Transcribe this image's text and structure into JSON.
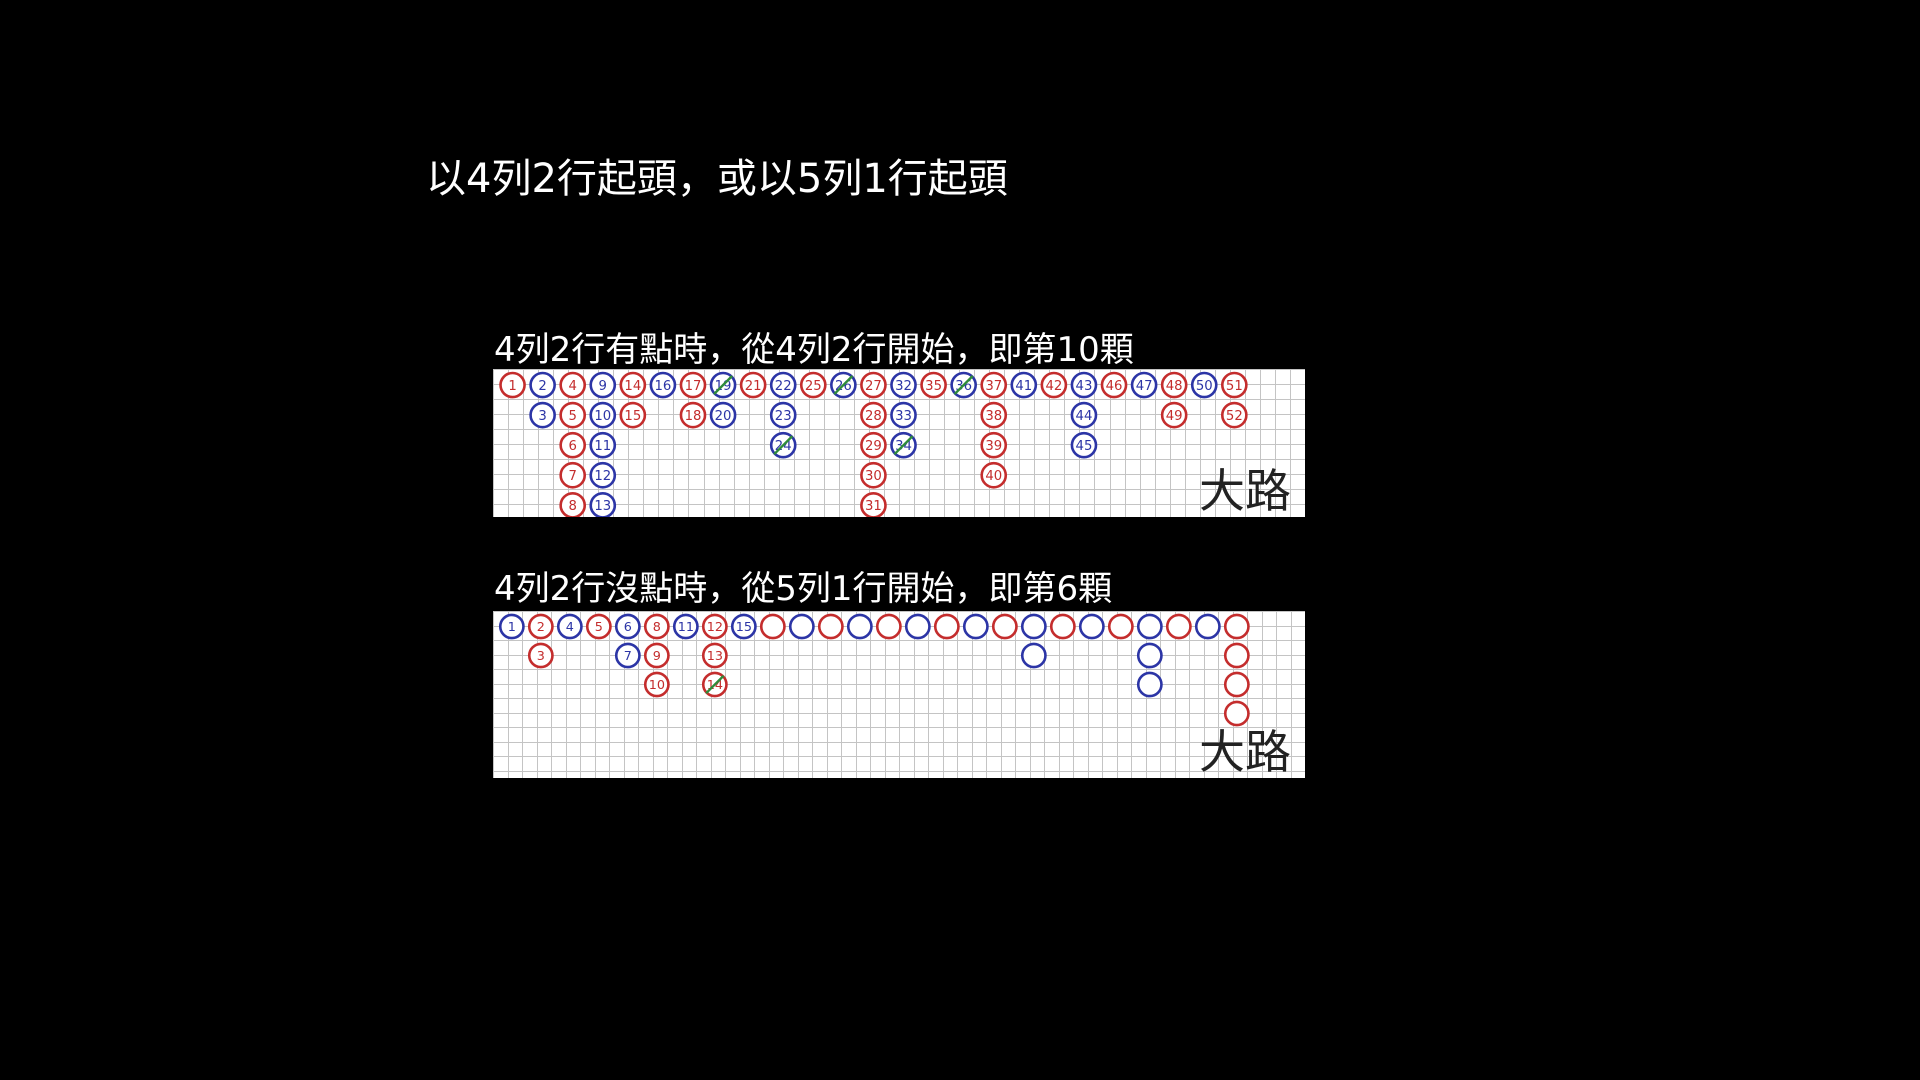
{
  "title": "以4列2行起頭，或以5列1行起頭",
  "colors": {
    "background": "#000000",
    "text": "#ffffff",
    "grid_bg": "#ffffff",
    "grid_line": "#c4c4c4",
    "banker": "#c42d2d",
    "player": "#2c35a6",
    "tie": "#2e8b3a"
  },
  "roads": [
    {
      "caption": "4列2行有點時，從4列2行開始，即第10顆",
      "label": "大路",
      "grid": {
        "cols": 27,
        "rows": 6
      },
      "beads": [
        {
          "col": 0,
          "row": 0,
          "color": "red",
          "n": "1"
        },
        {
          "col": 1,
          "row": 0,
          "color": "blue",
          "n": "2"
        },
        {
          "col": 1,
          "row": 1,
          "color": "blue",
          "n": "3"
        },
        {
          "col": 2,
          "row": 0,
          "color": "red",
          "n": "4"
        },
        {
          "col": 2,
          "row": 1,
          "color": "red",
          "n": "5"
        },
        {
          "col": 2,
          "row": 2,
          "color": "red",
          "n": "6"
        },
        {
          "col": 2,
          "row": 3,
          "color": "red",
          "n": "7"
        },
        {
          "col": 2,
          "row": 4,
          "color": "red",
          "n": "8"
        },
        {
          "col": 3,
          "row": 0,
          "color": "blue",
          "n": "9"
        },
        {
          "col": 3,
          "row": 1,
          "color": "blue",
          "n": "10"
        },
        {
          "col": 3,
          "row": 2,
          "color": "blue",
          "n": "11"
        },
        {
          "col": 3,
          "row": 3,
          "color": "blue",
          "n": "12"
        },
        {
          "col": 3,
          "row": 4,
          "color": "blue",
          "n": "13"
        },
        {
          "col": 4,
          "row": 0,
          "color": "red",
          "n": "14"
        },
        {
          "col": 4,
          "row": 1,
          "color": "red",
          "n": "15"
        },
        {
          "col": 5,
          "row": 0,
          "color": "blue",
          "n": "16"
        },
        {
          "col": 6,
          "row": 0,
          "color": "red",
          "n": "17"
        },
        {
          "col": 6,
          "row": 1,
          "color": "red",
          "n": "18"
        },
        {
          "col": 7,
          "row": 0,
          "color": "blue",
          "n": "19",
          "tie": true
        },
        {
          "col": 7,
          "row": 1,
          "color": "blue",
          "n": "20"
        },
        {
          "col": 8,
          "row": 0,
          "color": "red",
          "n": "21"
        },
        {
          "col": 9,
          "row": 0,
          "color": "blue",
          "n": "22"
        },
        {
          "col": 9,
          "row": 1,
          "color": "blue",
          "n": "23"
        },
        {
          "col": 9,
          "row": 2,
          "color": "blue",
          "n": "24",
          "tie": true
        },
        {
          "col": 10,
          "row": 0,
          "color": "red",
          "n": "25"
        },
        {
          "col": 11,
          "row": 0,
          "color": "blue",
          "n": "26",
          "tie": true
        },
        {
          "col": 12,
          "row": 0,
          "color": "red",
          "n": "27"
        },
        {
          "col": 12,
          "row": 1,
          "color": "red",
          "n": "28"
        },
        {
          "col": 12,
          "row": 2,
          "color": "red",
          "n": "29"
        },
        {
          "col": 12,
          "row": 3,
          "color": "red",
          "n": "30"
        },
        {
          "col": 12,
          "row": 4,
          "color": "red",
          "n": "31"
        },
        {
          "col": 13,
          "row": 0,
          "color": "blue",
          "n": "32"
        },
        {
          "col": 13,
          "row": 1,
          "color": "blue",
          "n": "33"
        },
        {
          "col": 13,
          "row": 2,
          "color": "blue",
          "n": "34",
          "tie": true
        },
        {
          "col": 14,
          "row": 0,
          "color": "red",
          "n": "35"
        },
        {
          "col": 15,
          "row": 0,
          "color": "blue",
          "n": "36",
          "tie": true
        },
        {
          "col": 16,
          "row": 0,
          "color": "red",
          "n": "37"
        },
        {
          "col": 16,
          "row": 1,
          "color": "red",
          "n": "38"
        },
        {
          "col": 16,
          "row": 2,
          "color": "red",
          "n": "39"
        },
        {
          "col": 16,
          "row": 3,
          "color": "red",
          "n": "40"
        },
        {
          "col": 17,
          "row": 0,
          "color": "blue",
          "n": "41"
        },
        {
          "col": 18,
          "row": 0,
          "color": "red",
          "n": "42"
        },
        {
          "col": 19,
          "row": 0,
          "color": "blue",
          "n": "43"
        },
        {
          "col": 19,
          "row": 1,
          "color": "blue",
          "n": "44"
        },
        {
          "col": 19,
          "row": 2,
          "color": "blue",
          "n": "45"
        },
        {
          "col": 20,
          "row": 0,
          "color": "red",
          "n": "46"
        },
        {
          "col": 21,
          "row": 0,
          "color": "blue",
          "n": "47"
        },
        {
          "col": 22,
          "row": 0,
          "color": "red",
          "n": "48"
        },
        {
          "col": 22,
          "row": 1,
          "color": "red",
          "n": "49"
        },
        {
          "col": 23,
          "row": 0,
          "color": "blue",
          "n": "50"
        },
        {
          "col": 24,
          "row": 0,
          "color": "red",
          "n": "51"
        },
        {
          "col": 24,
          "row": 1,
          "color": "red",
          "n": "52"
        }
      ]
    },
    {
      "caption": "4列2行沒點時，從5列1行開始，即第6顆",
      "label": "大路",
      "grid": {
        "cols": 28,
        "rows": 6
      },
      "beads": [
        {
          "col": 0,
          "row": 0,
          "color": "blue",
          "n": "1"
        },
        {
          "col": 1,
          "row": 0,
          "color": "red",
          "n": "2"
        },
        {
          "col": 1,
          "row": 1,
          "color": "red",
          "n": "3"
        },
        {
          "col": 2,
          "row": 0,
          "color": "blue",
          "n": "4"
        },
        {
          "col": 3,
          "row": 0,
          "color": "red",
          "n": "5"
        },
        {
          "col": 4,
          "row": 0,
          "color": "blue",
          "n": "6"
        },
        {
          "col": 4,
          "row": 1,
          "color": "blue",
          "n": "7"
        },
        {
          "col": 5,
          "row": 0,
          "color": "red",
          "n": "8"
        },
        {
          "col": 5,
          "row": 1,
          "color": "red",
          "n": "9"
        },
        {
          "col": 5,
          "row": 2,
          "color": "red",
          "n": "10"
        },
        {
          "col": 6,
          "row": 0,
          "color": "blue",
          "n": "11"
        },
        {
          "col": 7,
          "row": 0,
          "color": "red",
          "n": "12"
        },
        {
          "col": 7,
          "row": 1,
          "color": "red",
          "n": "13"
        },
        {
          "col": 7,
          "row": 2,
          "color": "red",
          "n": "14",
          "tie": true
        },
        {
          "col": 8,
          "row": 0,
          "color": "blue",
          "n": "15"
        },
        {
          "col": 9,
          "row": 0,
          "color": "red",
          "n": ""
        },
        {
          "col": 10,
          "row": 0,
          "color": "blue",
          "n": ""
        },
        {
          "col": 11,
          "row": 0,
          "color": "red",
          "n": ""
        },
        {
          "col": 12,
          "row": 0,
          "color": "blue",
          "n": ""
        },
        {
          "col": 13,
          "row": 0,
          "color": "red",
          "n": ""
        },
        {
          "col": 14,
          "row": 0,
          "color": "blue",
          "n": ""
        },
        {
          "col": 15,
          "row": 0,
          "color": "red",
          "n": ""
        },
        {
          "col": 16,
          "row": 0,
          "color": "blue",
          "n": ""
        },
        {
          "col": 17,
          "row": 0,
          "color": "red",
          "n": ""
        },
        {
          "col": 18,
          "row": 0,
          "color": "blue",
          "n": ""
        },
        {
          "col": 18,
          "row": 1,
          "color": "blue",
          "n": ""
        },
        {
          "col": 19,
          "row": 0,
          "color": "red",
          "n": ""
        },
        {
          "col": 20,
          "row": 0,
          "color": "blue",
          "n": ""
        },
        {
          "col": 21,
          "row": 0,
          "color": "red",
          "n": ""
        },
        {
          "col": 22,
          "row": 0,
          "color": "blue",
          "n": ""
        },
        {
          "col": 22,
          "row": 1,
          "color": "blue",
          "n": ""
        },
        {
          "col": 22,
          "row": 2,
          "color": "blue",
          "n": ""
        },
        {
          "col": 23,
          "row": 0,
          "color": "red",
          "n": ""
        },
        {
          "col": 24,
          "row": 0,
          "color": "blue",
          "n": ""
        },
        {
          "col": 25,
          "row": 0,
          "color": "red",
          "n": ""
        },
        {
          "col": 25,
          "row": 1,
          "color": "red",
          "n": ""
        },
        {
          "col": 25,
          "row": 2,
          "color": "red",
          "n": ""
        },
        {
          "col": 25,
          "row": 3,
          "color": "red",
          "n": ""
        }
      ]
    }
  ]
}
